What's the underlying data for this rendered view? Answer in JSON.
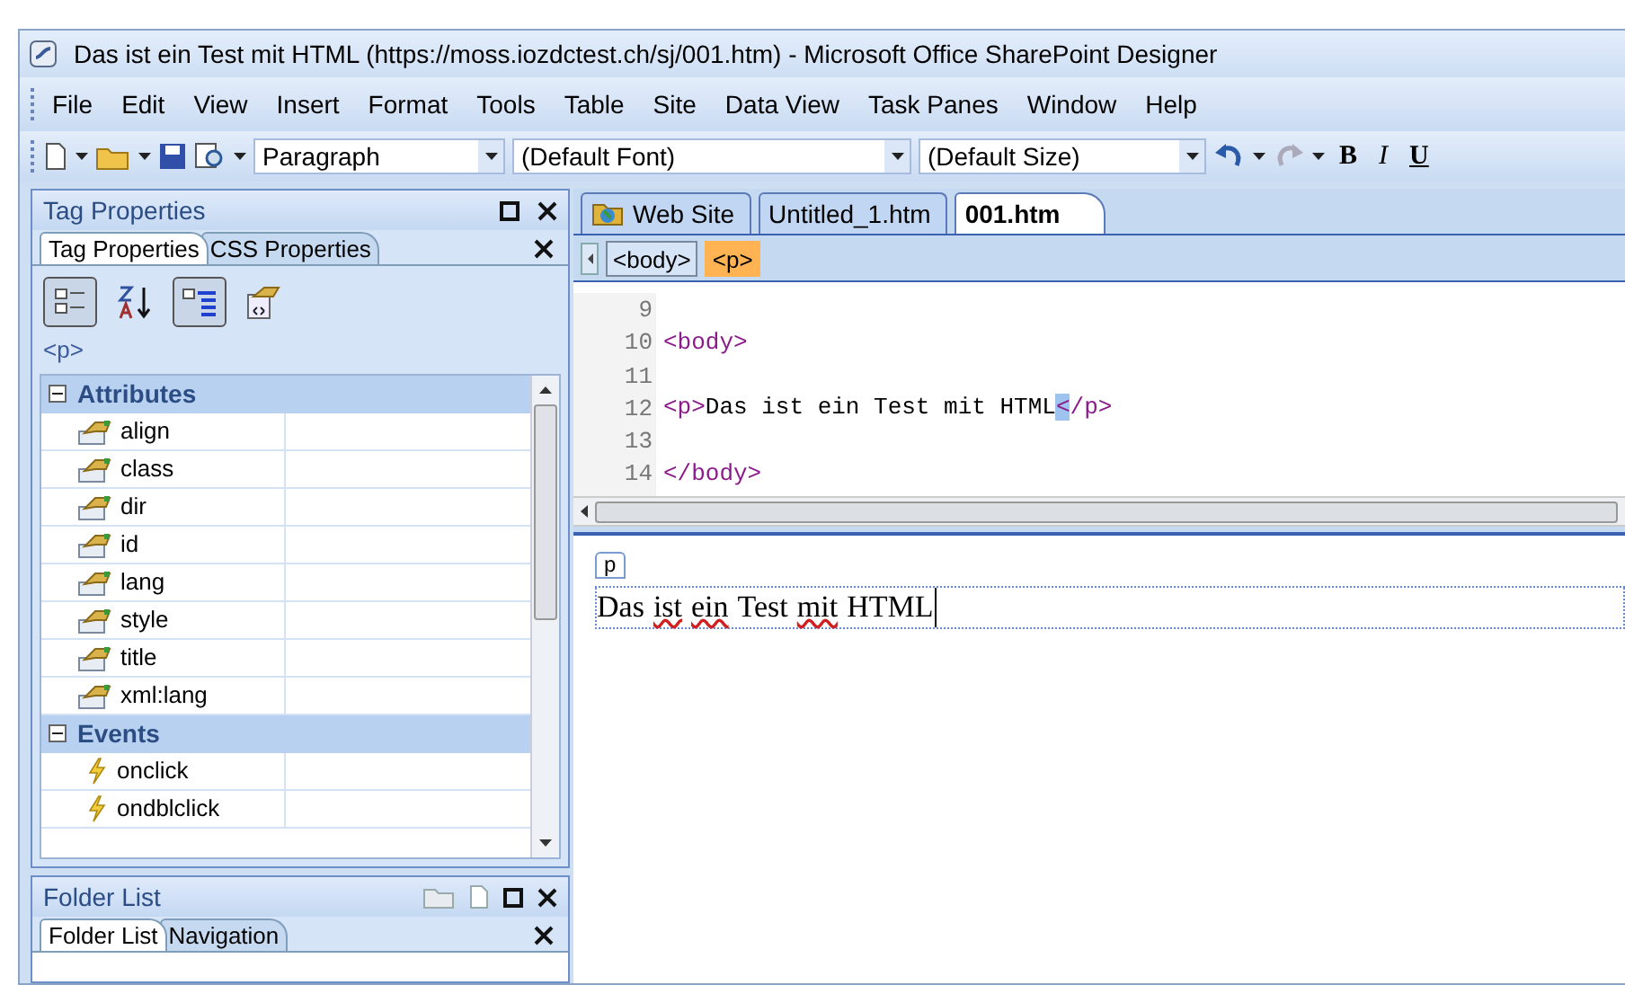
{
  "window": {
    "title": "Das ist ein Test mit HTML (https://moss.iozdctest.ch/sj/001.htm) - Microsoft Office SharePoint Designer"
  },
  "menu": [
    "File",
    "Edit",
    "View",
    "Insert",
    "Format",
    "Tools",
    "Table",
    "Site",
    "Data View",
    "Task Panes",
    "Window",
    "Help"
  ],
  "toolbar": {
    "style": "Paragraph",
    "font": "(Default Font)",
    "size": "(Default Size)",
    "bold": "B",
    "italic": "I",
    "underline": "U"
  },
  "tag_properties": {
    "title": "Tag Properties",
    "tabs": [
      {
        "label": "Tag Properties",
        "selected": true
      },
      {
        "label": "CSS Properties",
        "selected": false
      }
    ],
    "buttons": [
      {
        "kind": "categorized",
        "on": true
      },
      {
        "kind": "sort",
        "on": false
      },
      {
        "kind": "set-only",
        "on": true
      },
      {
        "kind": "tag-info",
        "on": false
      }
    ],
    "tag": "<p>",
    "groups": [
      {
        "name": "Attributes",
        "expanded": true,
        "rows": [
          {
            "kind": "attribute",
            "name": "align"
          },
          {
            "kind": "attribute",
            "name": "class"
          },
          {
            "kind": "attribute",
            "name": "dir"
          },
          {
            "kind": "attribute",
            "name": "id"
          },
          {
            "kind": "attribute",
            "name": "lang"
          },
          {
            "kind": "attribute",
            "name": "style"
          },
          {
            "kind": "attribute",
            "name": "title"
          },
          {
            "kind": "attribute",
            "name": "xml:lang"
          }
        ]
      },
      {
        "name": "Events",
        "expanded": true,
        "rows": [
          {
            "kind": "event",
            "name": "onclick"
          },
          {
            "kind": "event",
            "name": "ondblclick"
          }
        ]
      }
    ]
  },
  "folder_list": {
    "title": "Folder List",
    "tabs": [
      {
        "label": "Folder List",
        "selected": true
      },
      {
        "label": "Navigation",
        "selected": false
      }
    ]
  },
  "doc_tabs": [
    {
      "label": "Web Site",
      "kind": "site",
      "selected": false
    },
    {
      "label": "Untitled_1.htm",
      "kind": "page",
      "selected": false
    },
    {
      "label": "001.htm",
      "kind": "page",
      "selected": true
    }
  ],
  "breadcrumb": [
    {
      "label": "<body>",
      "selected": false
    },
    {
      "label": "<p>",
      "selected": true
    }
  ],
  "code": [
    {
      "number": "9"
    },
    {
      "number": "10",
      "parts": [
        {
          "kind": "tag",
          "text": "<body>"
        }
      ]
    },
    {
      "number": "11"
    },
    {
      "number": "12",
      "parts": [
        {
          "kind": "tag",
          "text": "<p>"
        },
        {
          "kind": "text",
          "text": "Das ist ein Test mit HTML"
        },
        {
          "kind": "selected",
          "text": "<"
        },
        {
          "kind": "tag",
          "text": "/p>"
        }
      ]
    },
    {
      "number": "13"
    },
    {
      "number": "14",
      "parts": [
        {
          "kind": "tag",
          "text": "</body>"
        }
      ]
    }
  ],
  "design": {
    "tag_label": "p",
    "words": [
      {
        "text": "Das",
        "misspelled": false
      },
      {
        "text": "ist",
        "misspelled": true
      },
      {
        "text": "ein",
        "misspelled": true
      },
      {
        "text": "Test",
        "misspelled": false
      },
      {
        "text": "mit",
        "misspelled": true
      },
      {
        "text": "HTML",
        "misspelled": false
      }
    ]
  }
}
